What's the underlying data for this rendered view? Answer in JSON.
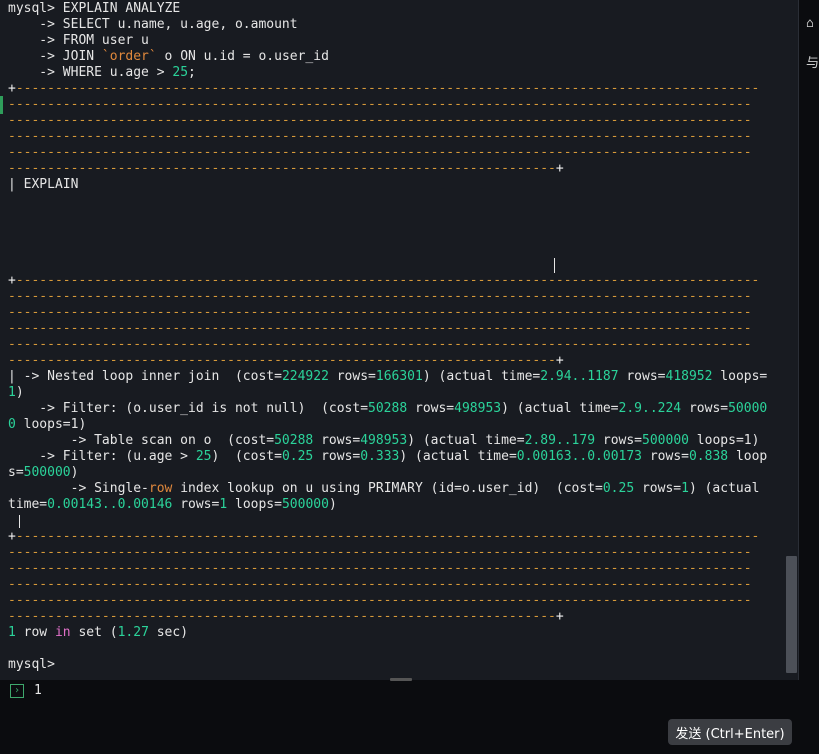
{
  "terminal": {
    "query": [
      "mysql> EXPLAIN ANALYZE",
      "    -> SELECT u.name, u.age, o.amount",
      "    -> FROM user u",
      "    -> JOIN `order` o ON u.id = o.user_id",
      "    -> WHERE u.age > 25;"
    ],
    "dash_full": "-----------------------------------------------------------------------------------------------",
    "dash_short": "----------------------------------------------------------------------",
    "header_label": "| EXPLAIN",
    "plan": {
      "l1_pre": "| -> Nested loop inner join  (cost=",
      "l1_v1": "224922",
      "l1_mid": " rows=",
      "l1_v2": "166301",
      "l1_mid2": ") (actual time=",
      "l1_v3": "2.94..1187",
      "l1_mid3": " rows=",
      "l1_v4": "418952",
      "l1_mid4": " loops=",
      "l2": "1)",
      "l3_pre": "    -> Filter: (o.user_id is not null)  (cost=",
      "l3_v1": "50288",
      "l3_mid": " rows=",
      "l3_v2": "498953",
      "l3_mid2": ") (actual time=",
      "l3_v3": "2.9..224",
      "l3_mid3": " rows=",
      "l3_v4": "50000",
      "l4_v": "0",
      "l4_rest": " loops=1)",
      "l5_pre": "        -> Table scan on o  (cost=",
      "l5_v1": "50288",
      "l5_mid": " rows=",
      "l5_v2": "498953",
      "l5_mid2": ") (actual time=",
      "l5_v3": "2.89..179",
      "l5_mid3": " rows=",
      "l5_v4": "500000",
      "l5_end": " loops=1)",
      "l6_pre": "    -> Filter: (u.age > ",
      "l6_v0": "25",
      "l6_mid0": ")  (cost=",
      "l6_v1": "0.25",
      "l6_mid": " rows=",
      "l6_v2": "0.333",
      "l6_mid2": ") (actual time=",
      "l6_v3": "0.00163..0.00173",
      "l6_mid3": " rows=",
      "l6_v4": "0.838",
      "l6_end": " loop",
      "l7_pre": "s=",
      "l7_v": "500000",
      "l7_end": ")",
      "l8_pre": "        -> Single-",
      "l8_kw": "row",
      "l8_mid": " index lookup on u using PRIMARY (id=o.user_id)  (cost=",
      "l8_v1": "0.25",
      "l8_mid2": " rows=",
      "l8_v2": "1",
      "l8_end": ") (actual",
      "l9_pre": "time=",
      "l9_v1": "0.00143..0.00146",
      "l9_mid": " rows=",
      "l9_v2": "1",
      "l9_mid2": " loops=",
      "l9_v3": "500000",
      "l9_end": ")"
    },
    "result": {
      "count": "1",
      "row_word": " row ",
      "in_word": "in",
      "set_word": " set (",
      "time": "1.27",
      "sec_word": " sec)"
    },
    "prompt": "mysql>"
  },
  "input": {
    "value": "1"
  },
  "send_button": {
    "label": "发送 (Ctrl+Enter)"
  },
  "right_strip": {
    "top_glyph": "⌂",
    "second_glyph": "与"
  }
}
